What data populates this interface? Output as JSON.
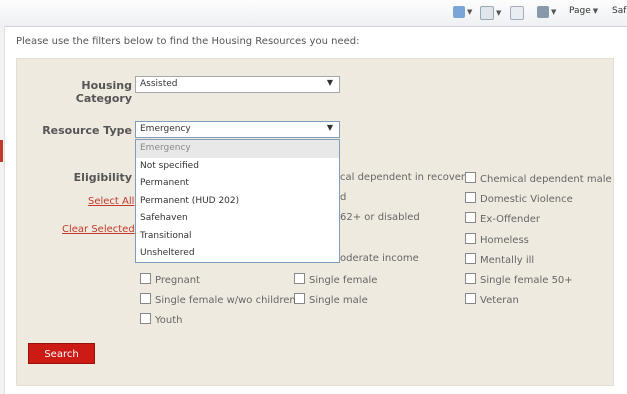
{
  "browser_toolbar": {
    "home_icon": "home-icon",
    "feeds_icon": "feeds-icon",
    "mail_icon": "mail-icon",
    "print_icon": "print-icon",
    "page_label": "Page",
    "safety_label": "Saf"
  },
  "intro_text": "Please use the filters below to find the Housing Resources you need:",
  "filters": {
    "housing_category": {
      "label": "Housing Category",
      "value": "Assisted"
    },
    "resource_type": {
      "label": "Resource Type",
      "value": "Emergency",
      "options": [
        "Emergency",
        "Not specified",
        "Permanent",
        "Permanent (HUD 202)",
        "Safehaven",
        "Transitional",
        "Unsheltered"
      ]
    },
    "eligibility": {
      "label": "Eligibility",
      "select_all": "Select All",
      "clear_selected": "Clear Selected",
      "col2": [
        "cal dependent in recovery",
        "d",
        "62+ or disabled",
        "oderate income",
        "Single female",
        "Single male"
      ],
      "col3": [
        "Chemical dependent male",
        "Domestic Violence",
        "Ex-Offender",
        "Homeless",
        "Mentally ill",
        "Single female 50+",
        "Veteran"
      ],
      "col1": [
        "Pregnant",
        "Single female w/wo children",
        "Youth"
      ]
    }
  },
  "search_button": "Search",
  "colors": {
    "accent": "#cc1a14",
    "panel": "#efeae0",
    "link": "#c0392b"
  }
}
